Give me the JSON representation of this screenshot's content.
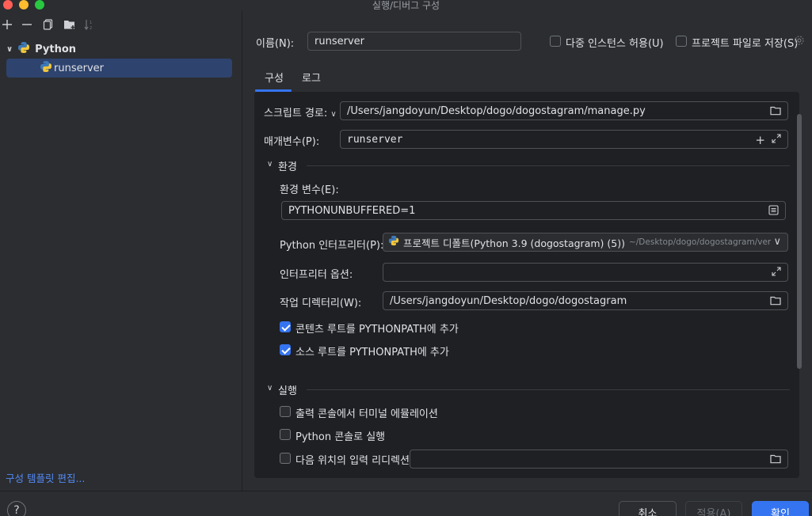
{
  "window": {
    "title": "실행/디버그 구성"
  },
  "colors": {
    "close": "#ff5f57",
    "minimize": "#febc2e",
    "maximize": "#28c840",
    "accent": "#3574f0",
    "selection": "#2e436e",
    "link": "#548af7"
  },
  "toolbar": {
    "icons": [
      "add-icon",
      "remove-icon",
      "copy-icon",
      "folder-add-icon",
      "sort-icon"
    ]
  },
  "tree": {
    "group_label": "Python",
    "item_label": "runserver"
  },
  "edit_templates_link": "구성 템플릿 편집...",
  "name": {
    "label": "이름(N):",
    "value": "runserver"
  },
  "options": {
    "allow_multiple": "다중 인스턴스 허용(U)",
    "store_as_project_file": "프로젝트 파일로 저장(S)"
  },
  "tabs": [
    "구성",
    "로그"
  ],
  "script": {
    "label": "스크립트 경로:",
    "value": "/Users/jangdoyun/Desktop/dogo/dogostagram/manage.py"
  },
  "params": {
    "label": "매개변수(P):",
    "value": "runserver"
  },
  "env_section": {
    "title": "환경",
    "env_vars_label": "환경 변수(E):",
    "env_vars_value": "PYTHONUNBUFFERED=1",
    "interpreter_label": "Python 인터프리터(P):",
    "interpreter_value": "프로젝트 디폴트(Python 3.9 (dogostagram) (5))",
    "interpreter_path": "~/Desktop/dogo/dogostagram/venv",
    "interpreter_options_label": "인터프리터 옵션:",
    "interpreter_options_value": "",
    "workdir_label": "작업 디렉터리(W):",
    "workdir_value": "/Users/jangdoyun/Desktop/dogo/dogostagram",
    "add_content_roots": "콘텐츠 루트를 PYTHONPATH에 추가",
    "add_source_roots": "소스 루트를 PYTHONPATH에 추가",
    "add_content_roots_checked": true,
    "add_source_roots_checked": true
  },
  "run_section": {
    "title": "실행",
    "emulate_terminal": "출력 콘솔에서 터미널 에뮬레이션",
    "run_with_console": "Python 콘솔로 실행",
    "redirect_input": "다음 위치의 입력 리디렉션:"
  },
  "footer": {
    "cancel": "취소",
    "apply": "적용(A)",
    "ok": "확인",
    "help": "?"
  }
}
